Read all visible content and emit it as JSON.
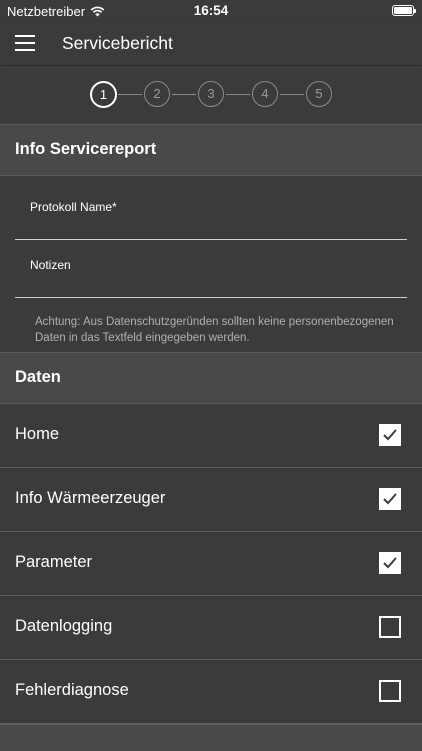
{
  "status_bar": {
    "carrier": "Netzbetreiber",
    "time": "16:54"
  },
  "app_bar": {
    "title": "Servicebericht"
  },
  "stepper": {
    "steps": [
      "1",
      "2",
      "3",
      "4",
      "5"
    ],
    "active": "1"
  },
  "info_section": {
    "title": "Info Servicereport",
    "protocol_label": "Protokoll Name*",
    "notes_label": "Notizen",
    "note_text": "Achtung: Aus Datenschutzgeründen sollten keine personenbezogenen Daten in das Textfeld eingegeben werden."
  },
  "data_section": {
    "title": "Daten",
    "items": [
      {
        "label": "Home",
        "checked": true
      },
      {
        "label": "Info Wärmeerzeuger",
        "checked": true
      },
      {
        "label": "Parameter",
        "checked": true
      },
      {
        "label": "Datenlogging",
        "checked": false
      },
      {
        "label": "Fehlerdiagnose",
        "checked": false
      }
    ]
  }
}
